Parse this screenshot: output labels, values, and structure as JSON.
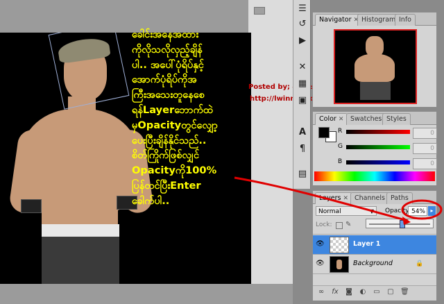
{
  "note_text": [
    "ခေါင်းအနေအထား",
    "ကိုလိုသလိုလှည့်ချိန်",
    "ပါ.. အပေါ်ပုံရိပ်နှင့်",
    "အောက်ပုံရိပ်ကိုအ",
    "ကြီးအသေးတူနေစေ",
    "ရန်Layerဘောက်ထဲ",
    "မှOpacityတွင်လျှော့",
    "ပေးပြီးချိန်နိုင်သည်..",
    "စိတ်ကြိုက်ဖြစ်လျှင်",
    "Opacityကို100%",
    "ပြန်တင်ပြီးEnter",
    "ခေါက်ပါ.."
  ],
  "credit": {
    "posted_by": "Posted by; လွင်မင်းဗိုလ်",
    "url": "http://lwinminbo.blogspot.com/"
  },
  "navigator": {
    "tabs": [
      "Navigator",
      "Histogram",
      "Info"
    ]
  },
  "color_panel": {
    "tabs": [
      "Color",
      "Swatches",
      "Styles"
    ],
    "channels": [
      {
        "label": "R",
        "value": "0"
      },
      {
        "label": "G",
        "value": "0"
      },
      {
        "label": "B",
        "value": "0"
      }
    ]
  },
  "layers_panel": {
    "tabs": [
      "Layers",
      "Channels",
      "Paths"
    ],
    "blend_mode": "Normal",
    "opacity_label": "Opacity:",
    "opacity_value": "54%",
    "opacity_fraction": 0.54,
    "lock_label": "Lock:",
    "layers": [
      {
        "name": "Layer 1",
        "selected": true
      },
      {
        "name": "Background",
        "selected": false,
        "locked": true
      }
    ]
  },
  "colors": {
    "note_text": "#ffff00",
    "annotation_red": "#e00000",
    "layer_selected": "#3d86e0",
    "credit_text": "#b00000"
  }
}
